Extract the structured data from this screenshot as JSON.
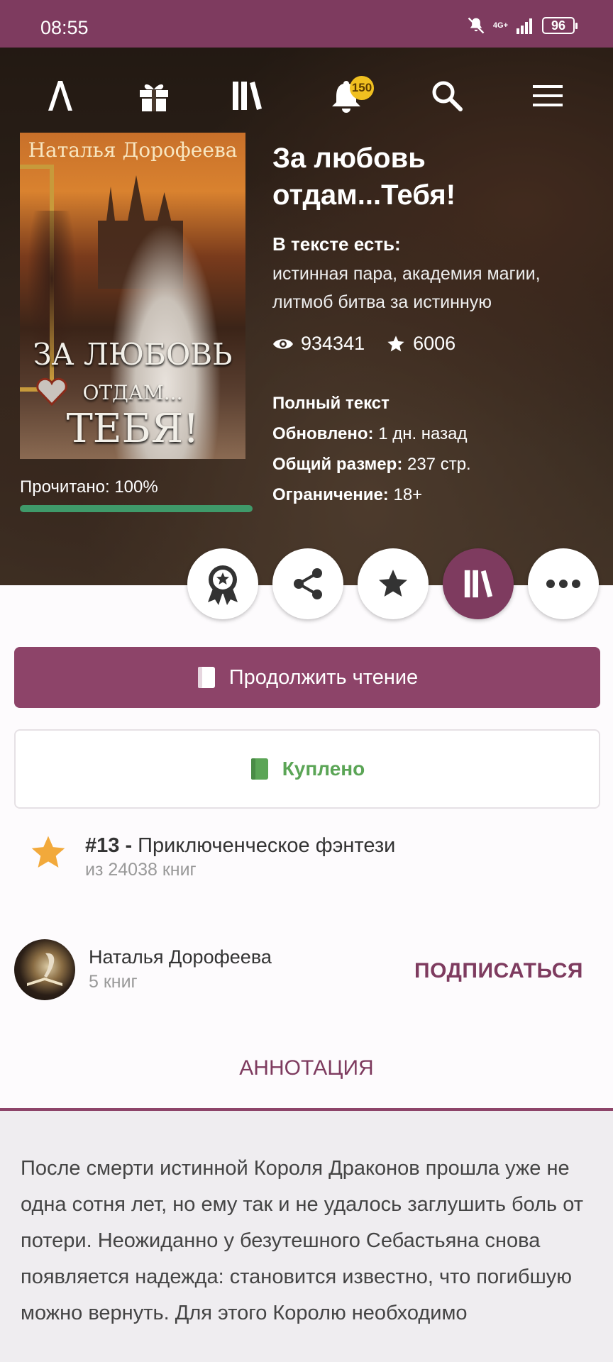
{
  "status_bar": {
    "time": "08:55",
    "network": "4G+",
    "battery": "96"
  },
  "nav": {
    "icons": [
      "logo-icon",
      "gift-icon",
      "library-icon",
      "bell-icon",
      "search-icon",
      "menu-icon"
    ],
    "notification_count": "150"
  },
  "book": {
    "cover_author": "Наталья Дорофеева",
    "cover_title_line1": "ЗА ЛЮБОВЬ",
    "cover_title_line2": "ОТДАМ...",
    "cover_title_line3": "ТЕБЯ!",
    "title": "За любовь отдам...Тебя!",
    "tags_label": "В тексте есть:",
    "tags": "истинная пара, академия магии, литмоб битва за истинную",
    "views": "934341",
    "likes": "6006",
    "status": "Полный текст",
    "updated_label": "Обновлено:",
    "updated_value": "1 дн. назад",
    "size_label": "Общий размер:",
    "size_value": "237 стр.",
    "restriction_label": "Ограничение:",
    "restriction_value": "18+",
    "progress_label": "Прочитано: 100%",
    "progress": 1.0
  },
  "actions": {
    "icons": [
      "award-icon",
      "share-icon",
      "star-icon",
      "library-icon",
      "more-icon"
    ]
  },
  "buttons": {
    "continue_label": "Продолжить чтение",
    "bought_label": "Куплено"
  },
  "rank": {
    "number": "#13 -",
    "category": "Приключенческое фэнтези",
    "of_total": "из 24038 книг"
  },
  "author": {
    "name": "Наталья Дорофеева",
    "books": "5 книг",
    "subscribe_label": "ПОДПИСАТЬСЯ"
  },
  "tabs": {
    "annotation": "АННОТАЦИЯ"
  },
  "annotation": {
    "text": "После смерти истинной Короля Драконов прошла уже не одна сотня лет, но ему так и не удалось заглушить боль от потери. Неожиданно у безутешного Себастьяна снова появляется надежда: становится известно, что погибшую можно вернуть. Для этого Королю необходимо"
  },
  "colors": {
    "brand": "#7e3b5f",
    "button": "#8d4469",
    "bought": "#5ba556",
    "progress": "#3f9a6a",
    "rank_star": "#f2a93b"
  }
}
